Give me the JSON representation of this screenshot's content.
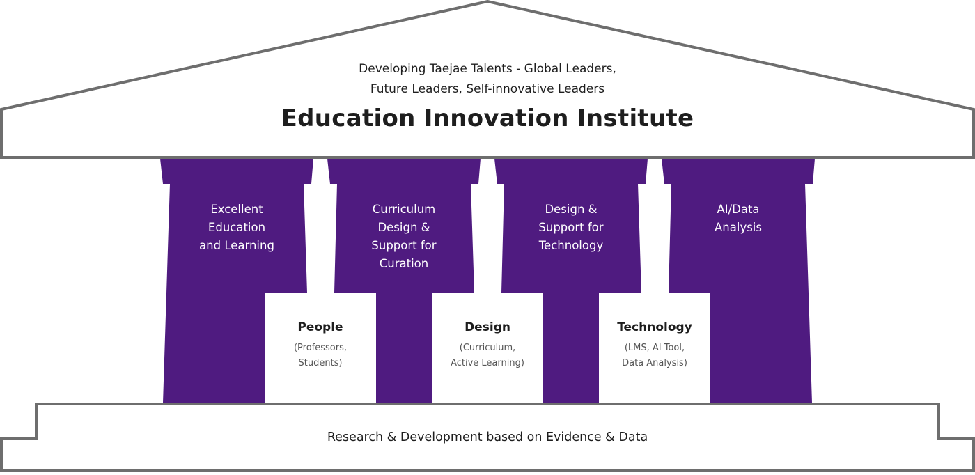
{
  "roof": {
    "subtitle_line1": "Developing Taejae Talents - Global Leaders,",
    "subtitle_line2": "Future Leaders, Self-innovative Leaders",
    "title": "Education Innovation Institute"
  },
  "pillars": [
    {
      "lines": [
        "Excellent",
        "Education",
        "and Learning"
      ]
    },
    {
      "lines": [
        "Curriculum",
        "Design &",
        "Support for",
        "Curation"
      ]
    },
    {
      "lines": [
        "Design &",
        "Support for",
        "Technology"
      ]
    },
    {
      "lines": [
        "AI/Data",
        "Analysis"
      ]
    }
  ],
  "arches": [
    {
      "title": "People",
      "desc_line1": "(Professors,",
      "desc_line2": "Students)"
    },
    {
      "title": "Design",
      "desc_line1": "(Curriculum,",
      "desc_line2": "Active Learning)"
    },
    {
      "title": "Technology",
      "desc_line1": "(LMS, AI Tool,",
      "desc_line2": "Data Analysis)"
    }
  ],
  "base": {
    "text": "Research & Development based on Evidence & Data"
  },
  "colors": {
    "pillar": "#4f1b80",
    "outline": "#6e6e6e",
    "text_dark": "#1e1e1e",
    "text_muted": "#555555"
  }
}
